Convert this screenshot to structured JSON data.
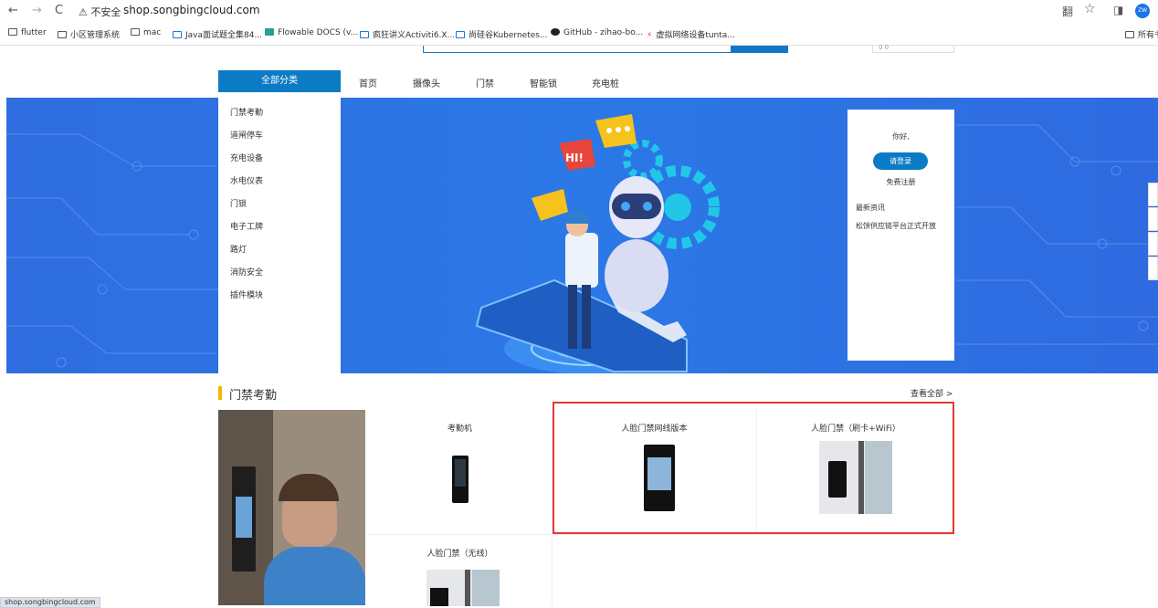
{
  "browser": {
    "nav": {
      "back": "←",
      "forward": "→",
      "reload": "C"
    },
    "security_label": "⚠ 不安全",
    "url": "shop.songbingcloud.com",
    "tools": {
      "translate": "翻",
      "star": "☆",
      "sidepanel": "◨"
    },
    "avatar_text": "ZW",
    "bookmarks": [
      {
        "label": "flutter",
        "icon": "folder-icon"
      },
      {
        "label": "小区管理系统",
        "icon": "folder-icon"
      },
      {
        "label": "mac",
        "icon": "folder-icon"
      },
      {
        "label": "Java面试题全集84...",
        "icon": "bilibili-icon"
      },
      {
        "label": "Flowable DOCS (v...",
        "icon": "flowable-icon"
      },
      {
        "label": "疯狂讲义Activiti6.X...",
        "icon": "bilibili-icon"
      },
      {
        "label": "尚硅谷Kubernetes...",
        "icon": "bilibili-icon"
      },
      {
        "label": "GitHub - zihao-bo...",
        "icon": "github-icon"
      },
      {
        "label": "虚拟网络设备tunta...",
        "icon": "bolt-icon"
      }
    ],
    "all_bookmarks": "所有书",
    "status_url": "shop.songbingcloud.com"
  },
  "header": {
    "cart_fragment": "0 0"
  },
  "nav": {
    "all_categories": "全部分类",
    "links": [
      "首页",
      "摄像头",
      "门禁",
      "智能锁",
      "充电桩"
    ]
  },
  "categories": [
    "门禁考勤",
    "道闸停车",
    "充电设备",
    "水电仪表",
    "门锁",
    "电子工牌",
    "路灯",
    "消防安全",
    "插件模块"
  ],
  "userbox": {
    "hello": "你好,",
    "login": "请登录",
    "register": "免费注册",
    "news": "最新资讯",
    "notice": "松饼供应链平台正式开放"
  },
  "banner": {
    "bubble_text": "HI!"
  },
  "section": {
    "title": "门禁考勤",
    "see_all": "查看全部 >",
    "products": [
      {
        "name": "考勤机"
      },
      {
        "name": "人脸门禁网线版本"
      },
      {
        "name": "人脸门禁（刷卡+WiFi）"
      },
      {
        "name": "人脸门禁（无线）"
      }
    ]
  },
  "colors": {
    "primary": "#0b7bc5",
    "banner": "#2b78e6",
    "accent": "#f5b700",
    "highlight": "#e53935"
  }
}
